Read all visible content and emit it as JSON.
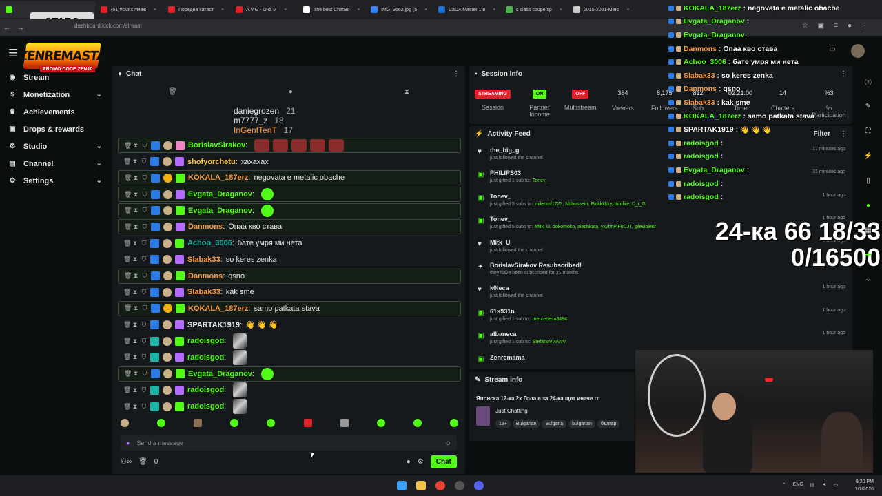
{
  "browser": {
    "tabs": [
      {
        "label": "(51)#смях #меж",
        "color": "#e0222b"
      },
      {
        "label": "Поредна катаст",
        "color": "#e0222b"
      },
      {
        "label": "A.V.G - Она м",
        "color": "#e0222b"
      },
      {
        "label": "The best ChatBo",
        "color": "#ffffff"
      },
      {
        "label": "IMG_3662.jpg (5",
        "color": "#3b82f6"
      },
      {
        "label": "CaDA Master 1:8",
        "color": "#1e6fd0"
      },
      {
        "label": "c class coupe sp",
        "color": "#4caf50"
      },
      {
        "label": "2015-2021-Merc",
        "color": "#cccccc"
      }
    ],
    "url": "dashboard.kick.com/stream"
  },
  "overlay_badge": "STARS",
  "logo_text": "ZENREMASTA",
  "promo": {
    "label": "PROMO CODE",
    "code": "ZEN10"
  },
  "sidebar": [
    {
      "label": "Stream",
      "icon": "broadcast-icon"
    },
    {
      "label": "Monetization",
      "icon": "dollar-icon",
      "chev": "⌄"
    },
    {
      "label": "Achievements",
      "icon": "trophy-icon"
    },
    {
      "label": "Drops & rewards",
      "icon": "gift-icon"
    },
    {
      "label": "Studio",
      "icon": "gear-icon",
      "chev": "⌄"
    },
    {
      "label": "Channel",
      "icon": "user-icon",
      "chev": "⌄"
    },
    {
      "label": "Settings",
      "icon": "settings-icon",
      "chev": "⌄"
    }
  ],
  "chat": {
    "title": "Chat",
    "gifters": [
      {
        "name": "daniegrozen",
        "count": "21"
      },
      {
        "name": "m7777_z",
        "count": "18"
      },
      {
        "name": "InGentTenT",
        "count": "17"
      }
    ],
    "messages": [
      {
        "user": "BorislavSirakov",
        "text": "",
        "color": "#53fc18",
        "hl": true,
        "emotes": 5
      },
      {
        "user": "shofyorchetu",
        "text": "хахахах",
        "color": "#f7c646",
        "hl": false
      },
      {
        "user": "KOKALA_187erz",
        "text": "negovata e metalic obache",
        "color": "#ff9a3c",
        "hl": true
      },
      {
        "user": "Evgata_Draganov",
        "text": "",
        "color": "#53fc18",
        "hl": true,
        "green": true
      },
      {
        "user": "Evgata_Draganov",
        "text": "",
        "color": "#53fc18",
        "hl": true,
        "green": true
      },
      {
        "user": "Danmons",
        "text": "Опаа кво става",
        "color": "#ff9a3c",
        "hl": true
      },
      {
        "user": "Achoo_3006",
        "text": "бате умря ми нета",
        "color": "#1fb5a6",
        "hl": false
      },
      {
        "user": "Slabak33",
        "text": "so keres zenka",
        "color": "#ff9a3c",
        "hl": false
      },
      {
        "user": "Danmons",
        "text": "qsno",
        "color": "#ff9a3c",
        "hl": true
      },
      {
        "user": "Slabak33",
        "text": "kak sme",
        "color": "#ff9a3c",
        "hl": false
      },
      {
        "user": "KOKALA_187erz",
        "text": "samo patkata stava",
        "color": "#ff9a3c",
        "hl": true
      },
      {
        "user": "SPARTAK1919",
        "text": "👋 👋 👋",
        "color": "#e8e8e8",
        "hl": false
      },
      {
        "user": "radoisgod",
        "text": "",
        "color": "#53fc18",
        "hl": false,
        "photo": true
      },
      {
        "user": "radoisgod",
        "text": "",
        "color": "#53fc18",
        "hl": false,
        "photo": true
      },
      {
        "user": "Evgata_Draganov",
        "text": "",
        "color": "#53fc18",
        "hl": true,
        "green": true
      },
      {
        "user": "radoisgod",
        "text": "",
        "color": "#53fc18",
        "hl": false,
        "photo": true
      },
      {
        "user": "radoisgod",
        "text": "",
        "color": "#53fc18",
        "hl": false,
        "photo": true
      }
    ],
    "placeholder": "Send a message",
    "points": "0",
    "send_label": "Chat"
  },
  "session": {
    "title": "Session Info",
    "streaming_pill": "STREAMING",
    "session_label": "Session",
    "partner_pill": "ON",
    "partner_label": "Partner Income",
    "multistream_pill": "OFF",
    "multistream_label": "Multistream",
    "viewers": "384",
    "viewers_label": "Viewers",
    "followers": "8,175",
    "followers_label": "Followers",
    "subs": "812",
    "subs_label": "Sub",
    "time": "02:21:00",
    "time_label": "Time",
    "chatters": "14",
    "chatters_label": "Chatters",
    "participation": "%3",
    "participation_label": "% Participation"
  },
  "activity": {
    "title": "Activity Feed",
    "filter": "Filter",
    "items": [
      {
        "name": "the_big_g",
        "desc": "just followed the channel",
        "hl": "",
        "time": "17 minutes ago",
        "icon": "heart-icon"
      },
      {
        "name": "PHILIPS03",
        "desc": "just gifted 1 sub to:",
        "hl": "Tonev_",
        "time": "31 minutes ago",
        "icon": "gift-icon"
      },
      {
        "name": "Tonev_",
        "desc": "just gifted 5 subs to:",
        "hl": "milenmf1723, Nbhussein, Rickkkkky, bonfire, D_i_G",
        "time": "1 hour ago",
        "icon": "gift-icon"
      },
      {
        "name": "Tonev_",
        "desc": "just gifted 5 subs to:",
        "hl": "Mitk_U, dokomoko, alechkata, yxvfmPjFuCJT, jplevioleur",
        "time": "1 hour ago",
        "icon": "gift-icon"
      },
      {
        "name": "Mitk_U",
        "desc": "just followed the channel",
        "hl": "",
        "time": "1 hour ago",
        "icon": "heart-icon"
      },
      {
        "name": "BorislavSirakov Resubscribed!",
        "desc": "they have been subscribed for 31 months",
        "hl": "",
        "time": "",
        "icon": "star-icon"
      },
      {
        "name": "k0leca",
        "desc": "just followed the channel",
        "hl": "",
        "time": "1 hour ago",
        "icon": "heart-icon"
      },
      {
        "name": "61×931n",
        "desc": "just gifted 1 sub to:",
        "hl": "mercedesa3484",
        "time": "1 hour ago",
        "icon": "gift-icon"
      },
      {
        "name": "albaneca",
        "desc": "just gifted 1 sub to:",
        "hl": "StefanoVvvVvV",
        "time": "1 hour ago",
        "icon": "gift-icon"
      },
      {
        "name": "Zenremama",
        "desc": "",
        "hl": "",
        "time": "",
        "icon": "gift-icon"
      }
    ]
  },
  "stream_info": {
    "title": "Stream info",
    "stream_title": "Японска 12-ка 2х Гола е за 24-ка щот иначе гг",
    "category": "Just Chatting",
    "tags": [
      "18+",
      "Bulgarian",
      "Bulgaria",
      "bulgarian",
      "българ"
    ]
  },
  "overlay_chat": [
    {
      "user": "KOKALA_187erz",
      "text": "negovata e metalic obache",
      "color": "#53fc18"
    },
    {
      "user": "Evgata_Draganov",
      "text": "",
      "color": "#53fc18"
    },
    {
      "user": "Evgata_Draganov",
      "text": "",
      "color": "#53fc18"
    },
    {
      "user": "Danmons",
      "text": "Опаа кво става",
      "color": "#ff9a3c"
    },
    {
      "user": "Achoo_3006",
      "text": "бате умря ми нета",
      "color": "#53fc18"
    },
    {
      "user": "Slabak33",
      "text": "so keres zenka",
      "color": "#ff9a3c"
    },
    {
      "user": "Danmons",
      "text": "qsno",
      "color": "#ff9a3c"
    },
    {
      "user": "Slabak33",
      "text": "kak sme",
      "color": "#ff9a3c"
    },
    {
      "user": "KOKALA_187erz",
      "text": "samo patkata stava",
      "color": "#53fc18"
    },
    {
      "user": "SPARTAK1919",
      "text": "👋 👋 👋",
      "color": "#ffffff"
    },
    {
      "user": "radoisgod",
      "text": "",
      "color": "#53fc18"
    },
    {
      "user": "radoisgod",
      "text": "",
      "color": "#53fc18"
    },
    {
      "user": "Evgata_Draganov",
      "text": "",
      "color": "#53fc18"
    },
    {
      "user": "radoisgod",
      "text": "",
      "color": "#53fc18"
    },
    {
      "user": "radoisgod",
      "text": "",
      "color": "#53fc18"
    }
  ],
  "goal": {
    "line1": "24-ка 66 18/33",
    "line2": "0/16500"
  },
  "taskbar": {
    "lang": "ENG",
    "time": "9:20 PM",
    "date": "1/7/2026"
  }
}
